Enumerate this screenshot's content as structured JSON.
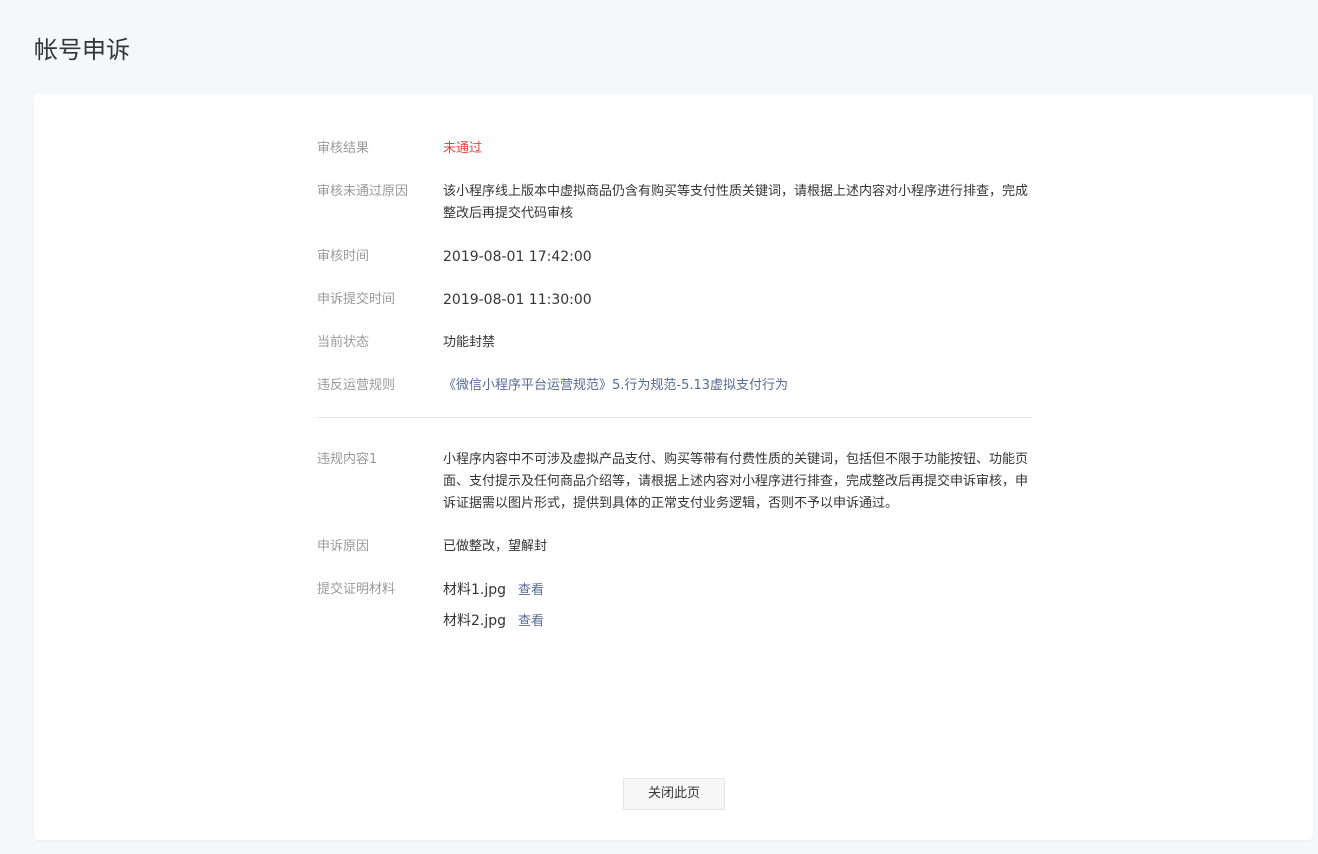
{
  "page_title": "帐号申诉",
  "details": {
    "result": {
      "label": "审核结果",
      "value": "未通过"
    },
    "reason": {
      "label": "审核未通过原因",
      "value": "该小程序线上版本中虚拟商品仍含有购买等支付性质关键词，请根据上述内容对小程序进行排查，完成整改后再提交代码审核"
    },
    "review_time": {
      "label": "审核时间",
      "value": "2019-08-01 17:42:00"
    },
    "appeal_time": {
      "label": "申诉提交时间",
      "value": "2019-08-01 11:30:00"
    },
    "status": {
      "label": "当前状态",
      "value": "功能封禁"
    },
    "rule": {
      "label": "违反运营规则",
      "value": "《微信小程序平台运营规范》5.行为规范-5.13虚拟支付行为"
    }
  },
  "violation": {
    "content": {
      "label": "违规内容1",
      "value": "小程序内容中不可涉及虚拟产品支付、购买等带有付费性质的关键词，包括但不限于功能按钮、功能页面、支付提示及任何商品介绍等，请根据上述内容对小程序进行排查，完成整改后再提交申诉审核，申诉证据需以图片形式，提供到具体的正常支付业务逻辑，否则不予以申诉通过。"
    },
    "appeal_reason": {
      "label": "申诉原因",
      "value": "已做整改，望解封"
    },
    "materials": {
      "label": "提交证明材料",
      "files": [
        {
          "name": "材料1.jpg",
          "action": "查看"
        },
        {
          "name": "材料2.jpg",
          "action": "查看"
        }
      ]
    }
  },
  "close_button": "关闭此页",
  "colors": {
    "error": "#e64340",
    "link": "#576b95"
  }
}
